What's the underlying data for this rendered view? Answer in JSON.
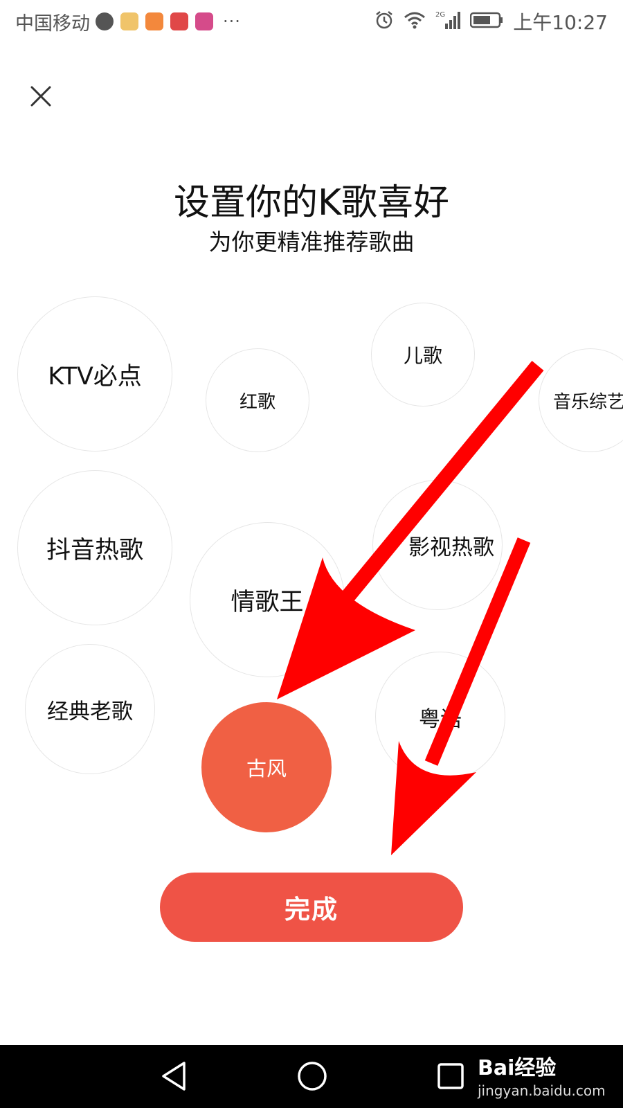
{
  "status_bar": {
    "carrier": "中国移动",
    "more": "···",
    "network": "2G",
    "time": "上午10:27"
  },
  "page": {
    "title": "设置你的K歌喜好",
    "subtitle": "为你更精准推荐歌曲"
  },
  "genres": [
    {
      "label": "KTV必点",
      "selected": false
    },
    {
      "label": "红歌",
      "selected": false
    },
    {
      "label": "儿歌",
      "selected": false
    },
    {
      "label": "音乐综艺",
      "selected": false
    },
    {
      "label": "抖音热歌",
      "selected": false
    },
    {
      "label": "影视热歌",
      "selected": false
    },
    {
      "label": "情歌王",
      "selected": false
    },
    {
      "label": "经典老歌",
      "selected": false
    },
    {
      "label": "粤语",
      "selected": false
    },
    {
      "label": "古风",
      "selected": true
    }
  ],
  "done_button": {
    "label": "完成"
  },
  "watermark": {
    "main": "Bai经验",
    "sub": "jingyan.baidu.com"
  },
  "colors": {
    "selected_bubble": "#f06044",
    "done_button": "#ef5346",
    "annotation_arrow": "#ff0000"
  }
}
